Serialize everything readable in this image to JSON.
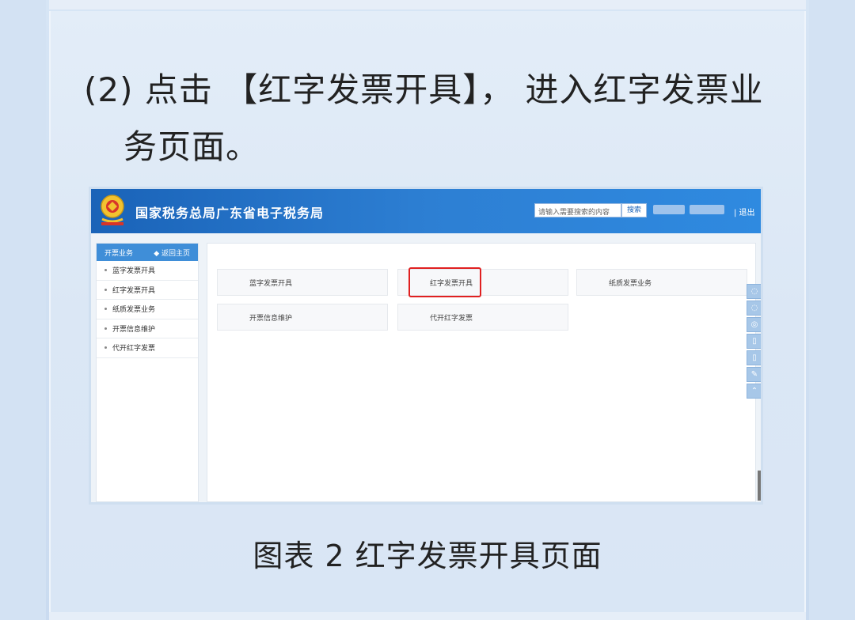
{
  "instruction": {
    "line1": "(2) 点击 【红字发票开具】， 进入红字发票业",
    "line2": "务页面。"
  },
  "screenshot": {
    "site_title": "国家税务总局广东省电子税务局",
    "search": {
      "placeholder": "请输入需要搜索的内容",
      "button": "搜索"
    },
    "logout": "| 退出",
    "sidebar": {
      "header": "开票业务",
      "back": "◆ 返回主页",
      "items": [
        {
          "label": "蓝字发票开具"
        },
        {
          "label": "红字发票开具"
        },
        {
          "label": "纸质发票业务"
        },
        {
          "label": "开票信息维护"
        },
        {
          "label": "代开红字发票"
        }
      ]
    },
    "cards": [
      {
        "label": "蓝字发票开具"
      },
      {
        "label": "红字发票开具"
      },
      {
        "label": "纸质发票业务"
      },
      {
        "label": "开票信息维护"
      },
      {
        "label": "代开红字发票"
      }
    ]
  },
  "caption": "图表 2 红字发票开具页面",
  "colors": {
    "header": "#2d7fd3",
    "highlight": "#e02020",
    "sidebar_head": "#3f8ed8"
  }
}
